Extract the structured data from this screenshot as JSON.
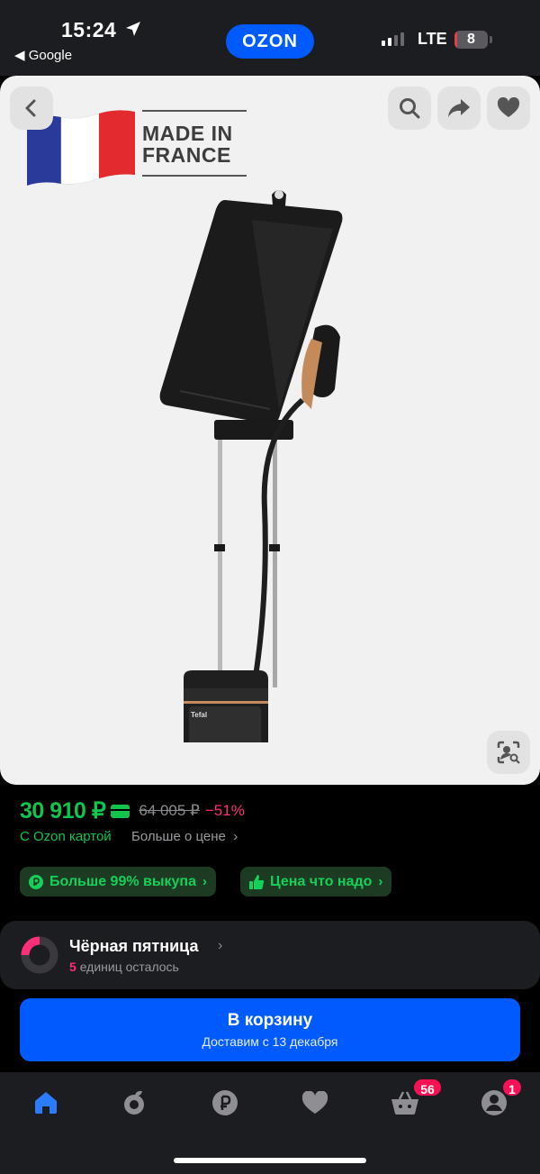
{
  "status_bar": {
    "time": "15:24",
    "back_app": "◀ Google",
    "network": "LTE",
    "battery": "8",
    "battery_level": 0.08
  },
  "app": {
    "logo": "OZON",
    "accent_color": "#005bff"
  },
  "toolbar": {
    "back_icon": "chevron-left-icon",
    "search_icon": "search-icon",
    "share_icon": "share-icon",
    "favorite_icon": "heart-icon",
    "visual_search_icon": "visual-search-icon"
  },
  "hero": {
    "badge_line1": "MADE IN",
    "badge_line2": "FRANCE",
    "product_brand": "Tefal"
  },
  "price": {
    "current": "30 910 ₽",
    "old": "64 005 ₽",
    "discount": "−51%",
    "ozon_card_label": "С Ozon картой",
    "more_label": "Больше о цене",
    "price_color": "#10c44c",
    "discount_color": "#ff2e78"
  },
  "chips": [
    {
      "label": "Больше 99% выкупа",
      "icon": "ruble-return-icon"
    },
    {
      "label": "Цена что надо",
      "icon": "thumbs-up-icon"
    }
  ],
  "promo": {
    "title": "Чёрная пятница",
    "count": "5",
    "subtitle_rest": "единиц осталось"
  },
  "cart_button": {
    "label": "В корзину",
    "sublabel": "Доставим с 13 декабря"
  },
  "tabbar": {
    "items": [
      {
        "icon": "home-icon",
        "active": true
      },
      {
        "icon": "fresh-icon"
      },
      {
        "icon": "ruble-icon"
      },
      {
        "icon": "heart-icon"
      },
      {
        "icon": "basket-icon",
        "badge": "56"
      },
      {
        "icon": "profile-icon",
        "badge": "1"
      }
    ]
  }
}
